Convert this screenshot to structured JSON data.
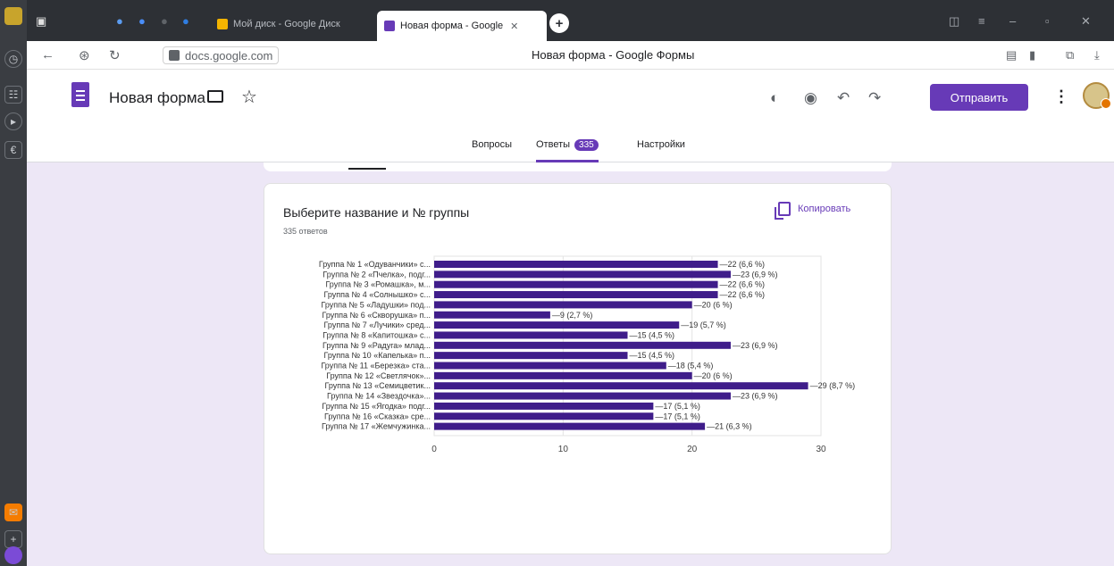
{
  "browser": {
    "tabs": [
      {
        "label": "Мой диск - Google Диск",
        "active": false
      },
      {
        "label": "Новая форма - Google",
        "active": true
      }
    ],
    "url": "docs.google.com",
    "page_title": "Новая форма - Google Формы"
  },
  "form": {
    "title": "Новая форма",
    "send_label": "Отправить",
    "tabs": {
      "questions": "Вопросы",
      "answers": "Ответы",
      "answers_count": "335",
      "settings": "Настройки"
    },
    "accent": "#673ab7"
  },
  "question": {
    "title": "Выберите  название и № группы",
    "count": "335 ответов",
    "copy_label": "Копировать"
  },
  "chart_data": {
    "type": "bar",
    "orientation": "horizontal",
    "color": "#3f1d8a",
    "categories": [
      "Группа № 1 «Одуванчики» с...",
      "Группа № 2 «Пчелка», подг...",
      "Группа № 3 «Ромашка», м...",
      "Группа № 4 «Солнышко» с...",
      "Группа № 5 «Ладушки» под...",
      "Группа № 6 «Скворушка» п...",
      "Группа № 7 «Лучики» сред...",
      "Группа № 8 «Капитошка» с...",
      "Группа № 9 «Радуга» млад...",
      "Группа № 10 «Капелька» п...",
      "Группа № 11 «Березка» ста...",
      "Группа № 12 «Светлячок»...",
      "Группа № 13 «Семицветик...",
      "Группа № 14 «Звездочка»...",
      "Группа № 15 «Ягодка» подг...",
      "Группа № 16 «Сказка» сре...",
      "Группа № 17 «Жемчужинка..."
    ],
    "values": [
      22,
      23,
      22,
      22,
      20,
      9,
      19,
      15,
      23,
      15,
      18,
      20,
      29,
      23,
      17,
      17,
      21
    ],
    "data_labels": [
      "22 (6,6 %)",
      "23 (6,9 %)",
      "22 (6,6 %)",
      "22 (6,6 %)",
      "20 (6 %)",
      "9 (2,7 %)",
      "19 (5,7 %)",
      "15 (4,5 %)",
      "23 (6,9 %)",
      "15 (4,5 %)",
      "18 (5,4 %)",
      "20 (6 %)",
      "29 (8,7 %)",
      "23 (6,9 %)",
      "17 (5,1 %)",
      "17 (5,1 %)",
      "21 (6,3 %)"
    ],
    "xlim": [
      0,
      30
    ],
    "xticks": [
      "0",
      "10",
      "20",
      "30"
    ],
    "grid": true
  }
}
